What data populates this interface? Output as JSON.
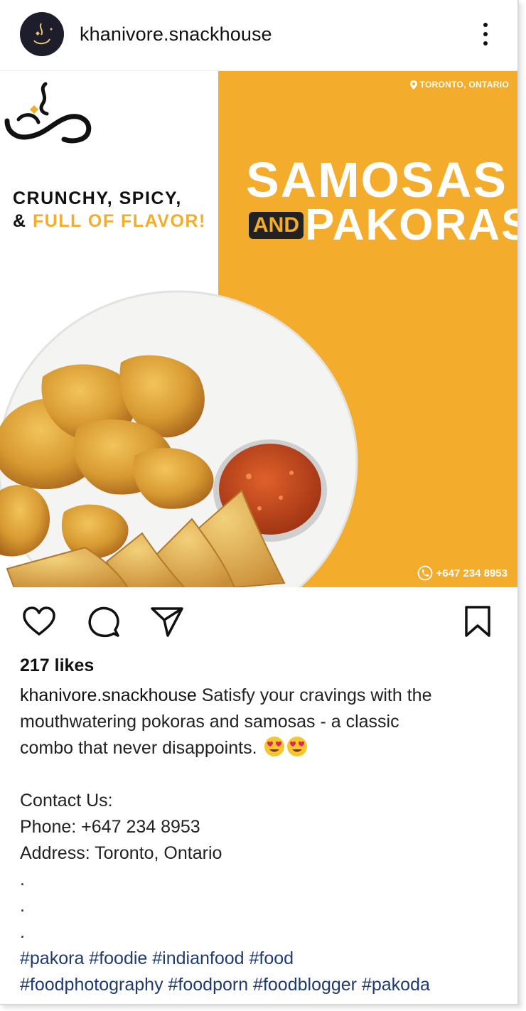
{
  "header": {
    "username": "khanivore.snackhouse",
    "more_icon": "more-vertical-icon"
  },
  "post_image": {
    "location": "TORONTO, ONTARIO",
    "title_line1": "SAMOSAS",
    "title_and": "AND",
    "title_line2": "PAKORAS",
    "tagline_line1": "CRUNCHY, SPICY,",
    "tagline_amp": "&",
    "tagline_accent": "FULL OF FLAVOR!",
    "phone": "+647 234 8953",
    "accent_color": "#f3ac2b"
  },
  "actions": {
    "like_icon": "heart-icon",
    "comment_icon": "comment-icon",
    "share_icon": "send-icon",
    "save_icon": "bookmark-icon"
  },
  "likes": "217 likes",
  "caption": {
    "username": "khanivore.snackhouse",
    "text_line1": "Satisfy your cravings with the",
    "text_line2": "mouthwatering pokoras and samosas - a classic",
    "text_line3": "combo that never disappoints.",
    "contact_heading": "Contact Us:",
    "phone_line": "Phone: +647 234 8953",
    "address_line": "Address: Toronto, Ontario",
    "dot": ".",
    "hashtags_line1": "#pakora #foodie #indianfood #food",
    "hashtags_line2": "#foodphotography #foodporn #foodblogger #pakoda"
  }
}
